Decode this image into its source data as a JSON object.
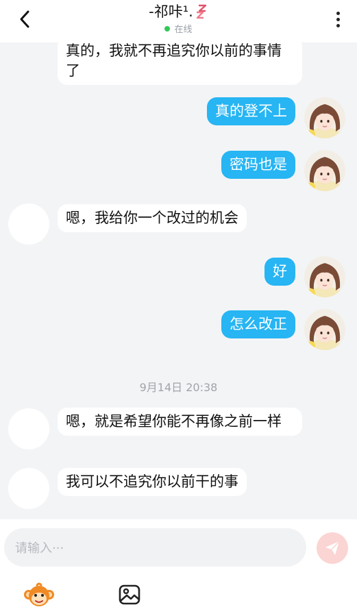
{
  "header": {
    "title": "-祁咔¹.",
    "status": "在线"
  },
  "messages": [
    {
      "side": "left",
      "text": "真的，我就不再追究你以前的事情了"
    },
    {
      "side": "right",
      "text": "真的登不上"
    },
    {
      "side": "right",
      "text": "密码也是"
    },
    {
      "side": "left",
      "text": "嗯，我给你一个改过的机会"
    },
    {
      "side": "right",
      "text": "好"
    },
    {
      "side": "right",
      "text": "怎么改正"
    },
    {
      "side": "left",
      "text": "嗯，就是希望你能不再像之前一样"
    },
    {
      "side": "left",
      "text": "我可以不追究你以前干的事"
    }
  ],
  "timestamp": "9月14日 20:38",
  "input": {
    "placeholder": "请输入···"
  },
  "icons": {
    "back": "chevron-left-icon",
    "more": "more-vertical-icon",
    "send": "send-icon",
    "emoji": "monkey-emoji-icon",
    "image": "image-icon"
  },
  "colors": {
    "right_bubble": "#27b5f3",
    "left_bubble": "#ffffff",
    "background": "#f3f4f6",
    "online_dot": "#34c759",
    "send_button": "#fbd5d3"
  }
}
